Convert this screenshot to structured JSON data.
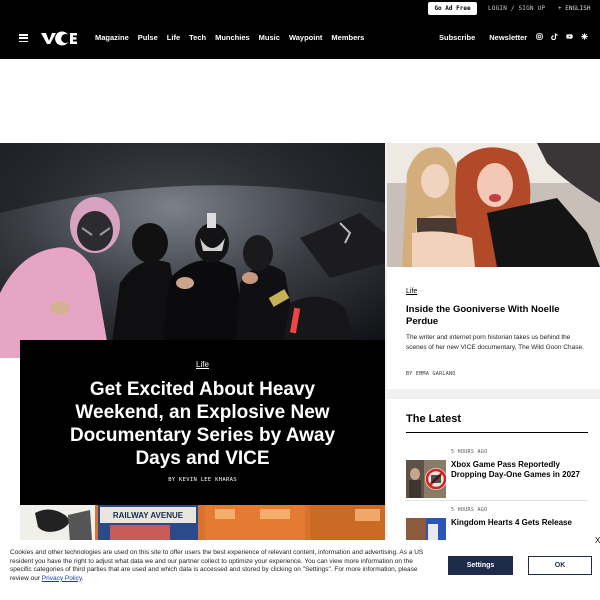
{
  "topbar": {
    "ad_free_label": "Go Ad Free",
    "login_label": "LOGIN / SIGN UP",
    "language_label": "+ ENGLISH"
  },
  "nav": {
    "logo_text": "VICE",
    "links": [
      "Magazine",
      "Pulse",
      "Life",
      "Tech",
      "Munchies",
      "Music",
      "Waypoint",
      "Members"
    ],
    "right_links": [
      "Subscribe",
      "Newsletter"
    ],
    "social_icons": [
      "instagram-icon",
      "tiktok-icon",
      "youtube-icon",
      "asterisk-icon"
    ]
  },
  "hero": {
    "category": "Life",
    "title": "Get Excited About Heavy Weekend, an Explosive New Documentary Series by Away Days and VICE",
    "byline": "BY KEVIN LEE KHARAS"
  },
  "side_article": {
    "category": "Life",
    "title": "Inside the Gooniverse With Noelle Perdue",
    "description": "The writer and internet porn historian takes us behind the scenes of her new VICE documentary, The Wild Goon Chase.",
    "byline": "BY EMMA GARLAND"
  },
  "latest": {
    "heading": "The Latest",
    "items": [
      {
        "time": "5 HOURS AGO",
        "title": "Xbox Game Pass Reportedly Dropping Day-One Games in 2027"
      },
      {
        "time": "5 HOURS AGO",
        "title": "Kingdom Hearts 4 Gets Release"
      }
    ]
  },
  "hero_bottom_sign": "RAILWAY AVENUE",
  "cookie": {
    "text": "Cookies and other technologies are used on this site to offer users the best experience of relevant content, information and advertising. As a US resident you have the right to adjust what data we and our partner collect to optimize your experience. You can view more information on the specific categories of third parties that are used and which data is accessed and stored by clicking on \"Settings\". For more information, please review our",
    "link": "Privacy Policy",
    "settings_label": "Settings",
    "ok_label": "OK",
    "close_label": "X"
  }
}
